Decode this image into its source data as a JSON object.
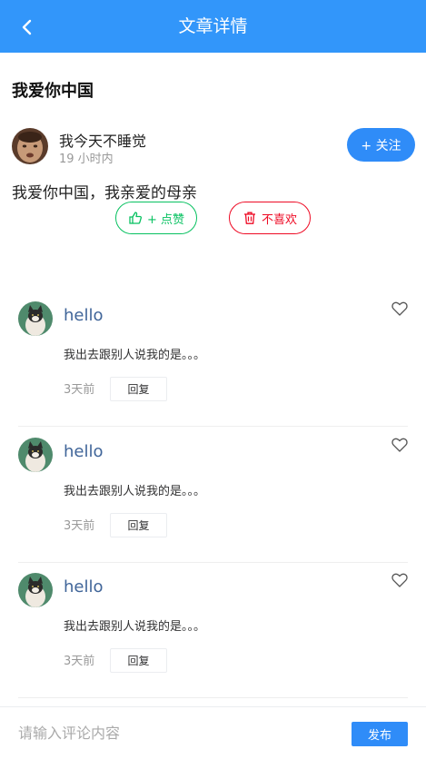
{
  "navbar": {
    "title": "文章详情",
    "back_icon": "chevron-left-icon"
  },
  "article": {
    "title": "我爱你中国",
    "author": {
      "name": "我今天不睡觉",
      "time": "19 小时内"
    },
    "follow_label": "+ 关注",
    "content": "我爱你中国，我亲爱的母亲",
    "like_label": "+ 点赞",
    "dislike_label": "不喜欢"
  },
  "comments": [
    {
      "name": "hello",
      "text": "我出去跟别人说我的是。。。",
      "time": "3天前",
      "reply_label": "回复"
    },
    {
      "name": "hello",
      "text": "我出去跟别人说我的是。。。",
      "time": "3天前",
      "reply_label": "回复"
    },
    {
      "name": "hello",
      "text": "我出去跟别人说我的是。。。",
      "time": "3天前",
      "reply_label": "回复"
    }
  ],
  "bottom": {
    "placeholder": "请输入评论内容",
    "publish_label": "发布"
  },
  "colors": {
    "primary": "#3296fa",
    "like": "#07c160",
    "dislike": "#ee0a24",
    "comment_name": "#406599"
  }
}
